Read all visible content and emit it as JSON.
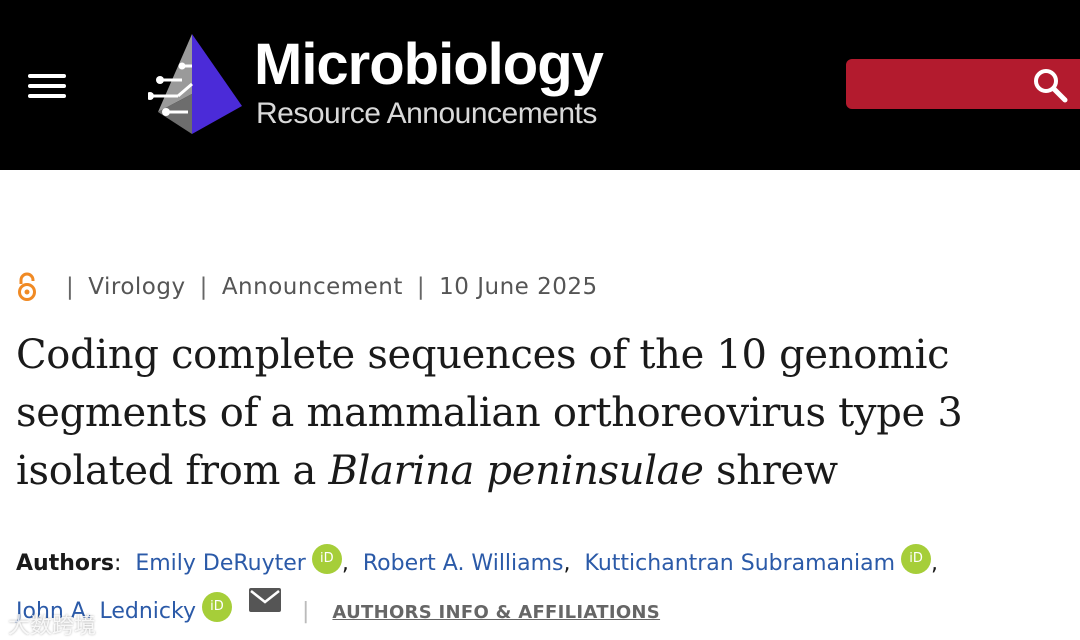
{
  "header": {
    "menu_icon": "hamburger-menu-icon",
    "logo": {
      "title": "Microbiology",
      "subtitle": "Resource Announcements"
    },
    "search_icon": "search-icon",
    "colors": {
      "background": "#000000",
      "search_box": "#b31b2e",
      "logo_blue": "#4b2bd8"
    }
  },
  "meta": {
    "access_icon": "open-access-icon",
    "category": "Virology",
    "article_type": "Announcement",
    "date": "10 June 2025",
    "separator": "|"
  },
  "article": {
    "title_part1": "Coding complete sequences of the 10 genomic segments of a mammalian orthoreovirus type 3 isolated from a ",
    "title_italic": "Blarina peninsulae",
    "title_part2": " shrew"
  },
  "authors": {
    "label": "Authors",
    "list": [
      {
        "name": "Emily DeRuyter",
        "orcid": true
      },
      {
        "name": "Robert A. Williams",
        "orcid": false
      },
      {
        "name": "Kuttichantran Subramaniam",
        "orcid": true
      },
      {
        "name": "John A. Lednicky",
        "orcid": true,
        "email": true
      }
    ],
    "orcid_badge": "iD",
    "affiliations_link": "AUTHORS INFO & AFFILIATIONS",
    "colors": {
      "link": "#2b5aa8",
      "orcid": "#a6ce39"
    }
  },
  "watermark": "大数跨境"
}
